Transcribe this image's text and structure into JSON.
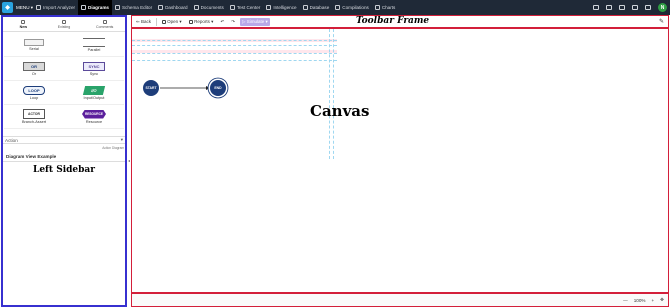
{
  "topnav": {
    "menu_label": "MENU ▾",
    "items": [
      {
        "label": "Import Analyzer"
      },
      {
        "label": "Diagrams"
      },
      {
        "label": "Schema Editor"
      },
      {
        "label": "Dashboard"
      },
      {
        "label": "Documents"
      },
      {
        "label": "Test Center"
      },
      {
        "label": "Intelligence"
      },
      {
        "label": "Database"
      },
      {
        "label": "Compilations"
      },
      {
        "label": "Charts"
      }
    ],
    "active_item": "Diagrams",
    "avatar_initial": "N"
  },
  "sidebar": {
    "tabs": [
      {
        "label": "New"
      },
      {
        "label": "Existing"
      },
      {
        "label": "Comments"
      }
    ],
    "palette": [
      {
        "label": "Serial",
        "shape_text": ""
      },
      {
        "label": "Parallel",
        "shape_text": ""
      },
      {
        "label": "Or",
        "shape_text": "OR"
      },
      {
        "label": "Sync",
        "shape_text": "SYNC"
      },
      {
        "label": "Loop",
        "shape_text": "LOOP"
      },
      {
        "label": "Input/Output",
        "shape_text": "I/O"
      },
      {
        "label": "Branch-Assert",
        "shape_text": "ACTOR"
      },
      {
        "label": "Resource",
        "shape_text": "RESOURCE"
      }
    ],
    "action_label": "Action",
    "action_diagram_label": "Action Diagram",
    "view_section_title": "Diagram View Example",
    "overlay_label": "Left Sidebar"
  },
  "toolbar": {
    "back_label": "Back",
    "open_label": "Open ▾",
    "reports_label": "Reports ▾",
    "undo_icon": "undo-icon",
    "redo_icon": "redo-icon",
    "simulate_label": "Simulate ▾",
    "overlay_label": "Toolbar Frame"
  },
  "canvas": {
    "start_label": "START",
    "end_label": "END",
    "overlay_label": "Canvas"
  },
  "statusbar": {
    "zoom_out": "—",
    "zoom_level": "100%",
    "zoom_in": "+",
    "fit_icon": "move-icon"
  },
  "colors": {
    "topbar": "#1f2937",
    "sidebar_border": "#3730d0",
    "frame_border": "#d31f3a",
    "node_fill": "#1d3d7a",
    "avatar": "#2e9c43"
  }
}
